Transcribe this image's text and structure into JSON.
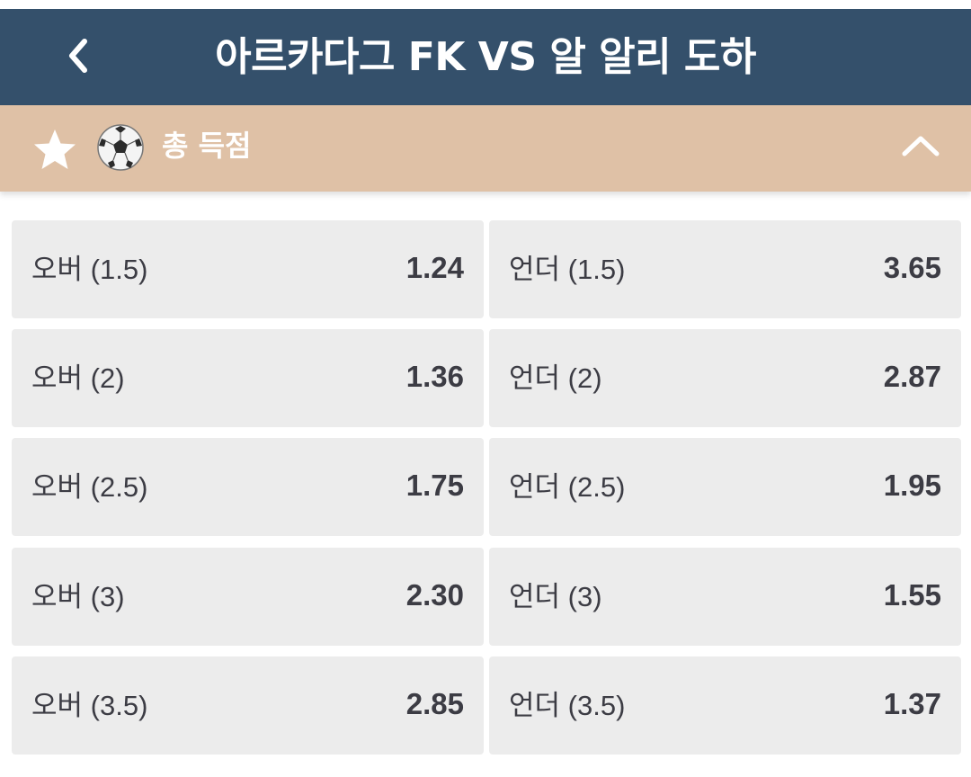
{
  "header": {
    "back_icon": "chevron-left-icon",
    "title": "아르카다그 FK VS 알 알리 도하"
  },
  "section": {
    "favorite_icon": "star-icon",
    "sport_icon": "soccer-ball-icon",
    "title": "총 득점",
    "collapse_icon": "chevron-up-icon"
  },
  "colors": {
    "header_bg": "#34506b",
    "section_bg": "#dfc1a6",
    "cell_bg": "#ececec",
    "text": "#3c3c44"
  },
  "markets": [
    {
      "over": {
        "label": "오버 (1.5)",
        "odds": "1.24"
      },
      "under": {
        "label": "언더 (1.5)",
        "odds": "3.65"
      }
    },
    {
      "over": {
        "label": "오버 (2)",
        "odds": "1.36"
      },
      "under": {
        "label": "언더 (2)",
        "odds": "2.87"
      }
    },
    {
      "over": {
        "label": "오버 (2.5)",
        "odds": "1.75"
      },
      "under": {
        "label": "언더 (2.5)",
        "odds": "1.95"
      }
    },
    {
      "over": {
        "label": "오버 (3)",
        "odds": "2.30"
      },
      "under": {
        "label": "언더 (3)",
        "odds": "1.55"
      }
    },
    {
      "over": {
        "label": "오버 (3.5)",
        "odds": "2.85"
      },
      "under": {
        "label": "언더 (3.5)",
        "odds": "1.37"
      }
    }
  ]
}
